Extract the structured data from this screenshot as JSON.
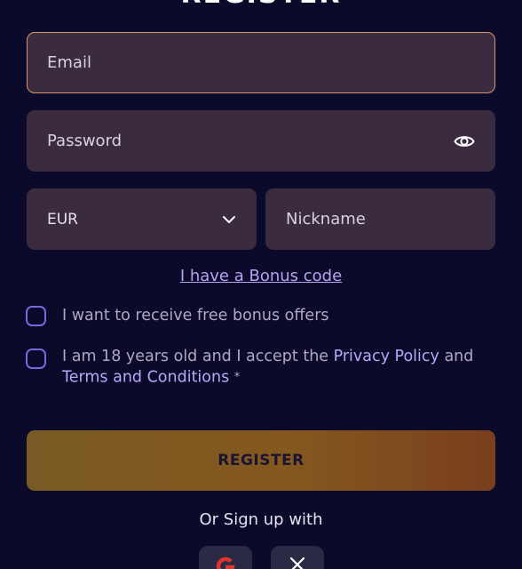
{
  "form": {
    "title": "REGISTER",
    "email_placeholder": "Email",
    "password_placeholder": "Password",
    "currency_value": "EUR",
    "nickname_placeholder": "Nickname",
    "bonus_link": "I have a Bonus code",
    "checkbox1_label": "I want to receive free bonus offers",
    "checkbox2_prefix": "I am 18 years old and I accept the ",
    "privacy_link": "Privacy Policy",
    "checkbox2_and": " and",
    "terms_link": "Terms and Conditions",
    "required_mark": "*",
    "register_label": "REGISTER",
    "or_signup": "Or Sign up with"
  },
  "icons": {
    "password_toggle": "eye-icon",
    "currency_dropdown": "chevron-down-icon",
    "social_1": "google-icon",
    "social_2": "x-icon"
  },
  "colors": {
    "background": "#0b0a2a",
    "field": "#3b2b3f",
    "focus_border": "#d6986e",
    "link": "#b8a9f8",
    "checkbox_border": "#7a66df",
    "register_button": "#84581f",
    "google_red": "#e1332f"
  }
}
